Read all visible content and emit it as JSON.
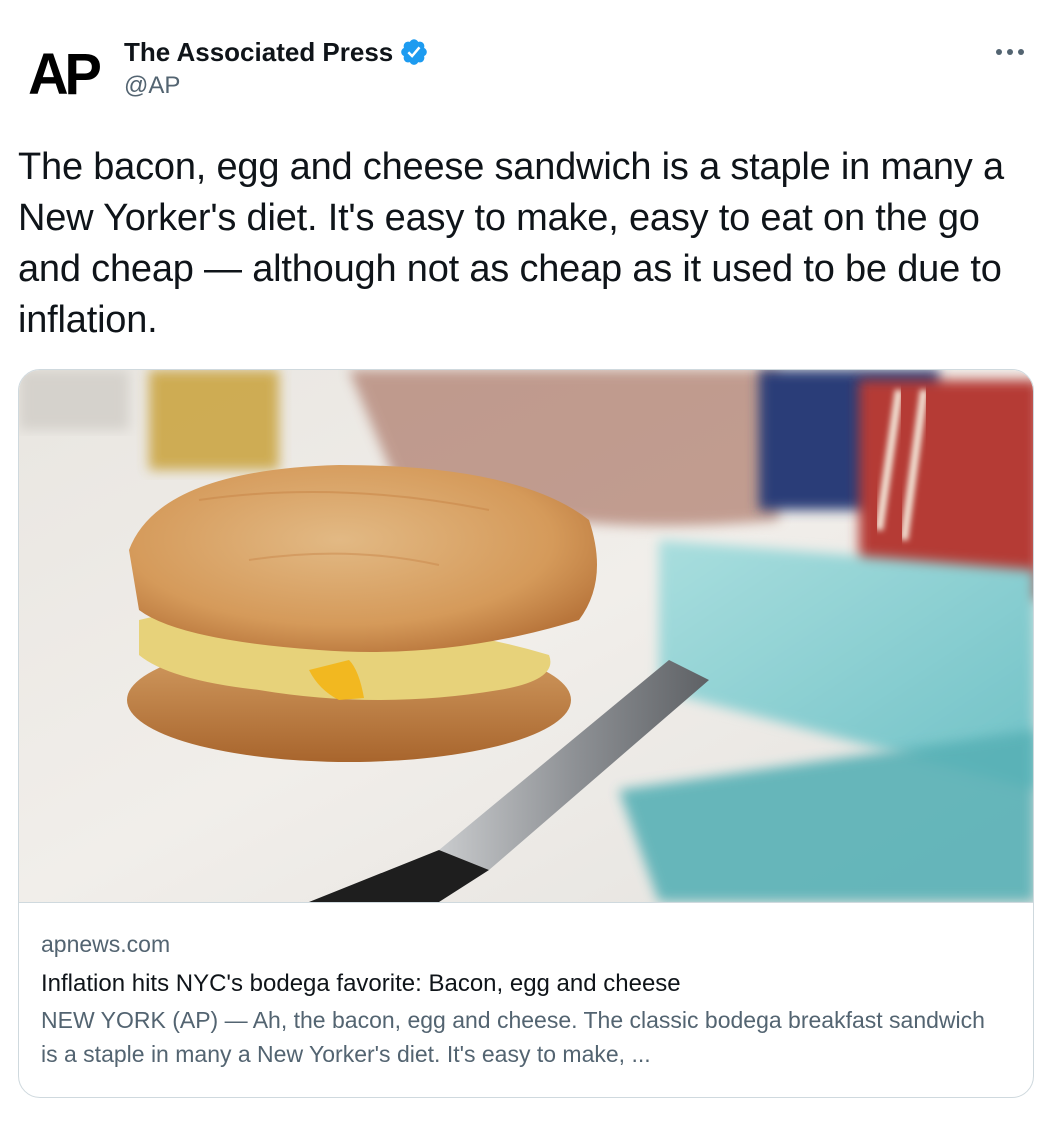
{
  "author": {
    "avatar_alt": "AP",
    "name": "The Associated Press",
    "handle": "@AP",
    "verified": true,
    "verified_icon": "verified-badge-icon"
  },
  "more_icon": "more-options-icon",
  "tweet": {
    "text": "The bacon, egg and cheese sandwich is a staple in many a New Yorker's diet. It's easy to make, easy to eat on the go and cheap — although not as cheap as it used to be due to inflation."
  },
  "card": {
    "domain": "apnews.com",
    "title": "Inflation hits NYC's bodega favorite: Bacon, egg and cheese",
    "description": "NEW YORK (AP) — Ah, the bacon, egg and cheese. The classic bodega breakfast sandwich is a staple in many a New Yorker's diet. It's easy to make, ..."
  },
  "colors": {
    "accent_blue": "#1d9bf0",
    "ap_red": "#e8432f",
    "text_primary": "#0f1419",
    "text_secondary": "#536471",
    "border": "#cfd9de"
  }
}
